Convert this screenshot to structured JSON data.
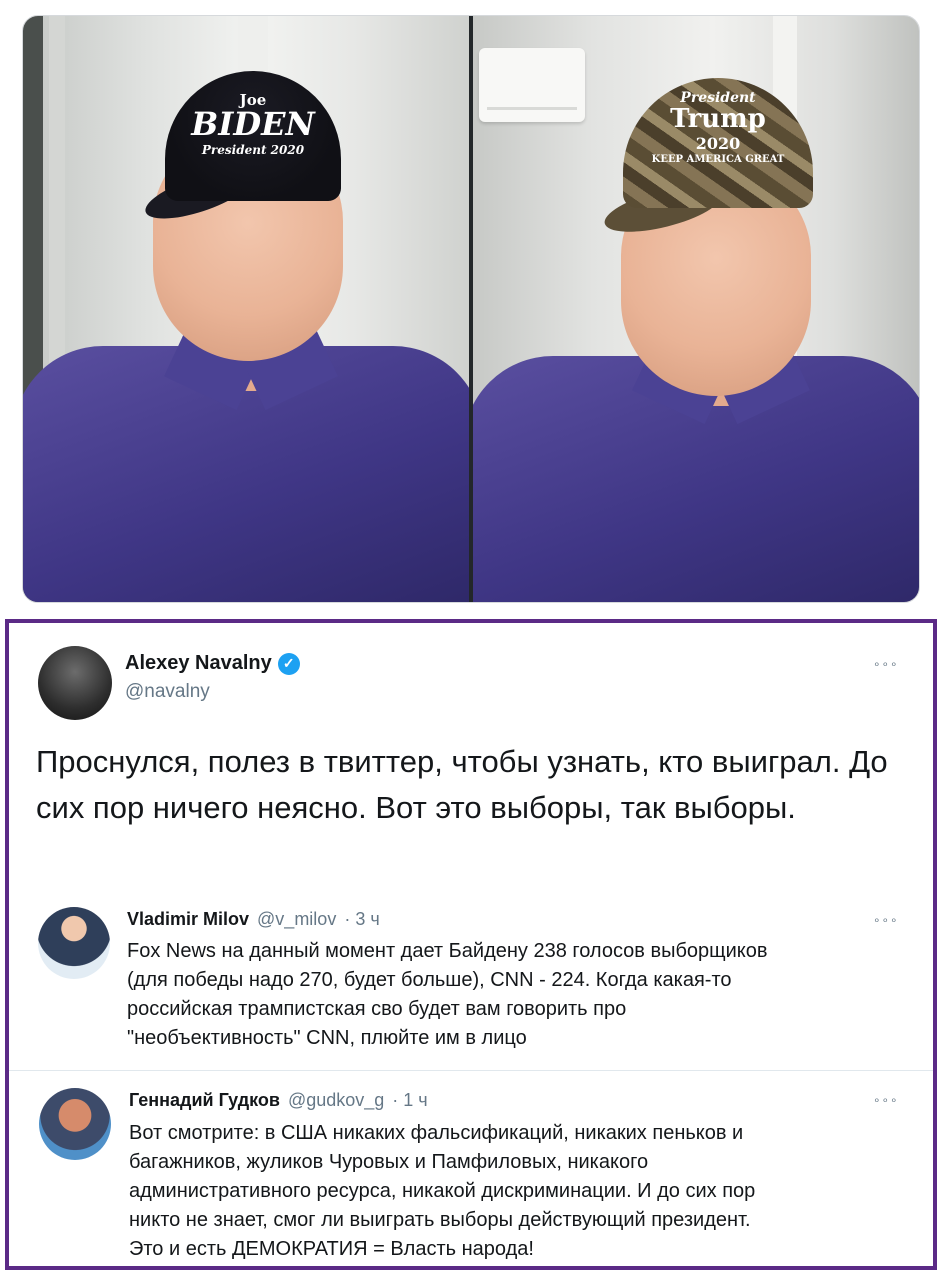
{
  "photos": {
    "left_cap": {
      "line1": "Joe",
      "line2": "BIDEN",
      "line3": "President 2020"
    },
    "right_cap": {
      "line1": "President",
      "line2": "Trump",
      "line3": "2020",
      "line4": "KEEP AMERICA GREAT"
    }
  },
  "tweet": {
    "author_name": "Alexey Navalny",
    "author_handle": "@navalny",
    "verified": true,
    "more_icon": "more-dots-icon",
    "text": "Проснулся, полез в твиттер, чтобы узнать, кто выиграл. До сих пор ничего неясно. Вот это выборы, так выборы."
  },
  "quoted": [
    {
      "name": "Vladimir Milov",
      "handle": "@v_milov",
      "time": "· 3 ч",
      "text_lines": [
        "Fox News на данный момент дает Байдену 238 голосов выборщиков",
        "(для победы надо 270, будет больше), CNN - 224. Когда какая-то",
        "российская трампистская сво будет вам говорить про",
        "\"необъективность\" CNN, плюйте им в лицо"
      ]
    },
    {
      "name": "Геннадий Гудков",
      "handle": "@gudkov_g",
      "time": "· 1 ч",
      "text_lines": [
        "Вот смотрите: в США никаких фальсификаций, никаких пеньков и",
        "багажников, жуликов Чуровых и Памфиловых, никакого",
        "административного ресурса, никакой дискриминации. И до сих пор",
        "никто не знает, смог ли выиграть выборы действующий президент.",
        "Это и есть ДЕМОКРАТИЯ = Власть народа!"
      ]
    }
  ],
  "ui": {
    "more_label": "∘∘∘",
    "verified_label": "✓"
  },
  "colors": {
    "border": "#5b2a86",
    "verified": "#1da1f2",
    "muted": "#657786"
  }
}
